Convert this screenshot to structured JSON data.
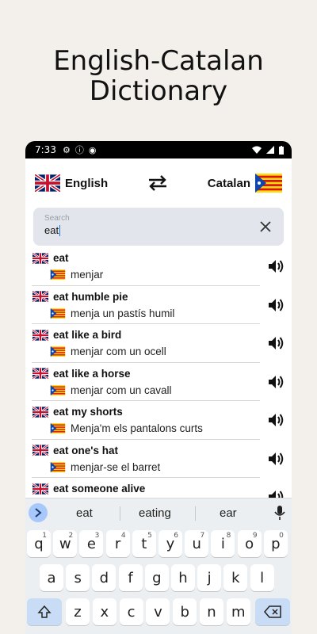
{
  "promo": {
    "title_line1": "English-Catalan",
    "title_line2": "Dictionary"
  },
  "status": {
    "time": "7:33"
  },
  "languages": {
    "source": "English",
    "target": "Catalan"
  },
  "search": {
    "placeholder": "Search",
    "value": "eat"
  },
  "results": [
    {
      "en": "eat",
      "ca": "menjar"
    },
    {
      "en": "eat humble pie",
      "ca": "menja un pastís humil"
    },
    {
      "en": "eat like a bird",
      "ca": "menjar com un ocell"
    },
    {
      "en": "eat like a horse",
      "ca": "menjar com un cavall"
    },
    {
      "en": "eat my shorts",
      "ca": "Menja'm els pantalons curts"
    },
    {
      "en": "eat one's hat",
      "ca": "menjar-se el barret"
    },
    {
      "en": "eat someone alive",
      "ca": ""
    }
  ],
  "keyboard": {
    "suggestions": [
      "eat",
      "eating",
      "ear"
    ],
    "row1": [
      [
        "q",
        "1"
      ],
      [
        "w",
        "2"
      ],
      [
        "e",
        "3"
      ],
      [
        "r",
        "4"
      ],
      [
        "t",
        "5"
      ],
      [
        "y",
        "6"
      ],
      [
        "u",
        "7"
      ],
      [
        "i",
        "8"
      ],
      [
        "o",
        "9"
      ],
      [
        "p",
        "0"
      ]
    ],
    "row2": [
      "a",
      "s",
      "d",
      "f",
      "g",
      "h",
      "j",
      "k",
      "l"
    ],
    "row3": [
      "z",
      "x",
      "c",
      "v",
      "b",
      "n",
      "m"
    ]
  },
  "colors": {
    "accent": "#1a73e8",
    "search_bg": "#e2e6ec",
    "keyboard_bg": "#eceff1"
  }
}
